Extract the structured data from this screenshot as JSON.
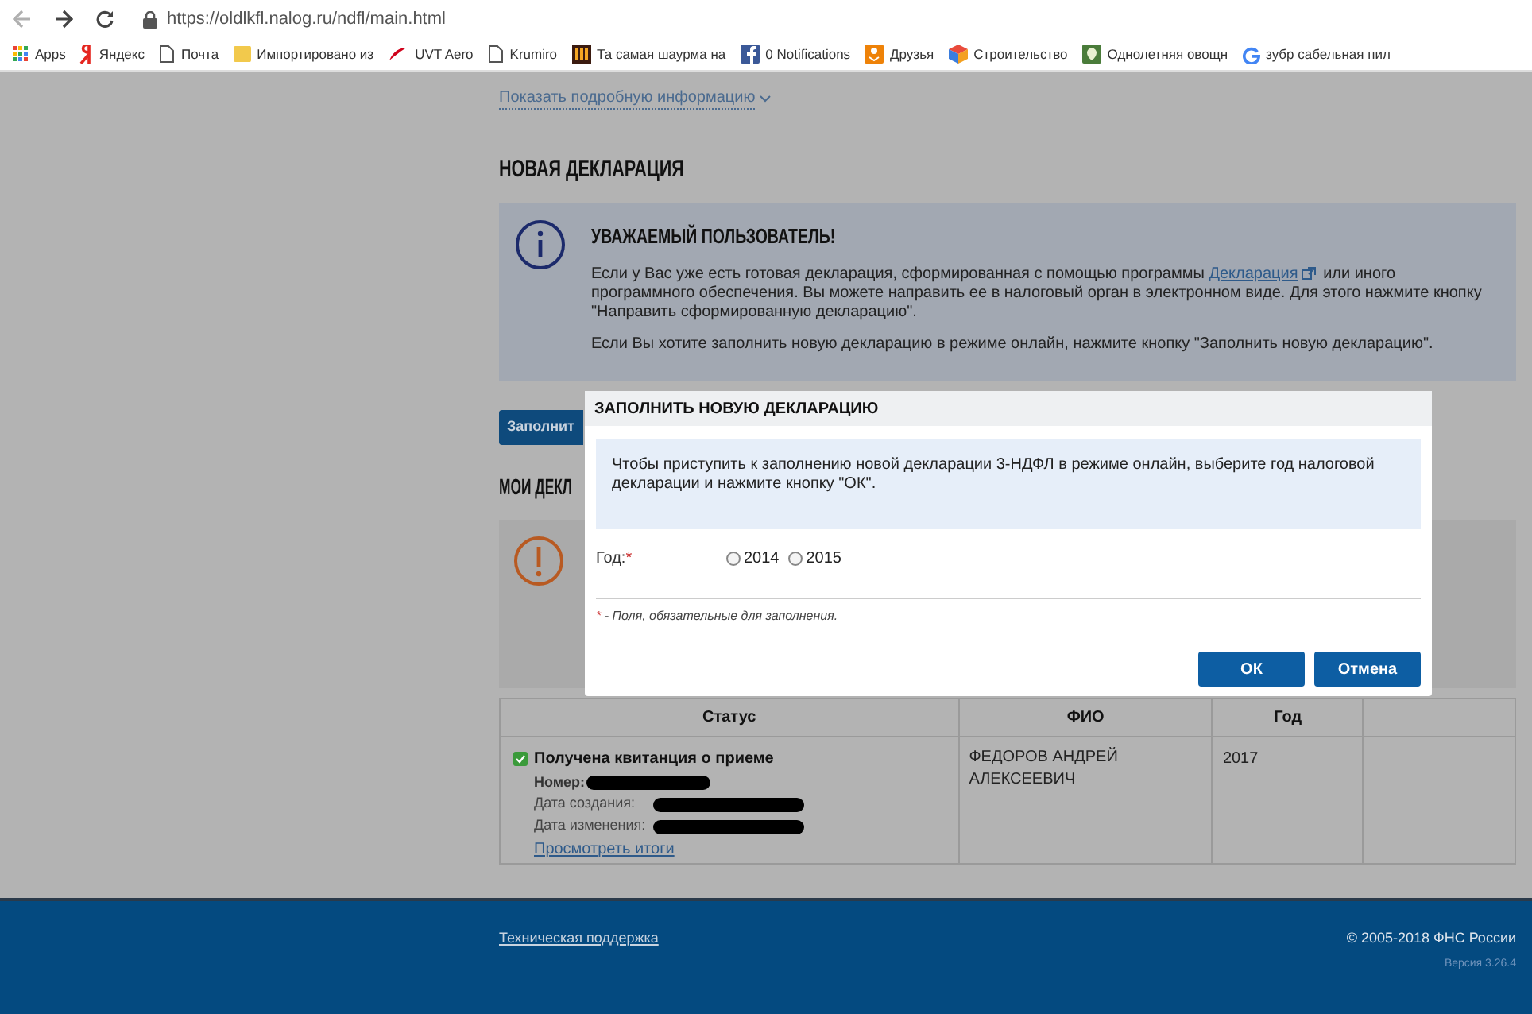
{
  "browser": {
    "url": "https://oldlkfl.nalog.ru/ndfl/main.html",
    "bookmarks": [
      {
        "label": "Apps"
      },
      {
        "label": "Яндекс"
      },
      {
        "label": "Почта"
      },
      {
        "label": "Импортировано из"
      },
      {
        "label": "UVT Aero"
      },
      {
        "label": "Krumiro"
      },
      {
        "label": "Та самая шаурма на"
      },
      {
        "label": "0 Notifications"
      },
      {
        "label": "Друзья"
      },
      {
        "label": "Строительство"
      },
      {
        "label": "Однолетняя овощн"
      },
      {
        "label": "зубр сабельная пил"
      }
    ]
  },
  "page": {
    "details_link": "Показать подробную информацию",
    "new_declaration": {
      "heading": "НОВАЯ ДЕКЛАРАЦИЯ",
      "notice_title": "УВАЖАЕМЫЙ ПОЛЬЗОВАТЕЛЬ!",
      "notice_text_before": "Если у Вас уже есть готовая декларация, сформированная с помощью программы",
      "notice_link": "Декларация",
      "notice_text_after": "или иного программного обеспечения. Вы можете направить ее в налоговый орган в электронном виде. Для этого нажмите кнопку \"Направить сформированную декларацию\".",
      "notice_text_2": "Если Вы хотите заполнить новую декларацию в режиме онлайн, нажмите кнопку \"Заполнить новую декларацию\".",
      "fill_button": "Заполнит"
    },
    "my_declarations": {
      "heading": "МОИ ДЕКЛ",
      "table": {
        "columns": [
          "Статус",
          "ФИО",
          "Год",
          ""
        ],
        "rows": [
          {
            "status": "Получена квитанция о приеме",
            "number_label": "Номер:",
            "created_label": "Дата создания:",
            "modified_label": "Дата изменения:",
            "results_link": "Просмотреть итоги",
            "name": "ФЕДОРОВ АНДРЕЙ АЛЕКСЕЕВИЧ",
            "year": "2017"
          }
        ]
      }
    }
  },
  "dialog": {
    "title": "ЗАПОЛНИТЬ НОВУЮ ДЕКЛАРАЦИЮ",
    "info": "Чтобы приступить к заполнению новой декларации 3-НДФЛ в режиме онлайн, выберите год налоговой декларации и нажмите кнопку \"ОК\".",
    "year_label": "Год:",
    "required_mark": "*",
    "years": [
      {
        "label": "2014",
        "selected": false
      },
      {
        "label": "2015",
        "selected": false
      }
    ],
    "note_mark": "*",
    "note": " - Поля, обязательные для заполнения.",
    "buttons": [
      "ОК",
      "Отмена"
    ]
  },
  "footer": {
    "support_link": "Техническая поддержка",
    "copyright": "© 2005-2018 ФНС России",
    "version": "Версия 3.26.4"
  }
}
